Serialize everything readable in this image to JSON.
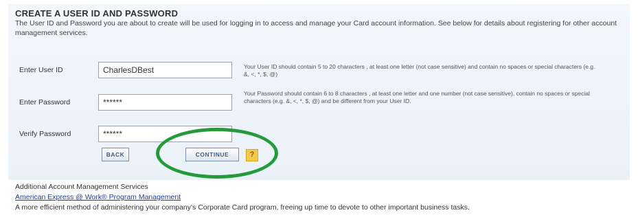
{
  "form": {
    "title": "CREATE A USER ID AND PASSWORD",
    "intro": "The User ID and Password you are about to create will be used for logging in to access and manage your Card account information. See below for details about registering for other account management services.",
    "user_id": {
      "label": "Enter User ID",
      "value": "CharlesDBest",
      "hint": "Your User ID should contain 5 to 20 characters , at least one letter (not case sensitive) and contain no spaces or special characters (e.g. &, <, *, $, @)"
    },
    "password": {
      "label": "Enter Password",
      "value": "******",
      "hint": "Your Password should contain 6 to 8 characters , at least one letter and one number (not case sensitive), contain no spaces or special characters (e.g. &, <, *, $, @) and be different from your User ID."
    },
    "verify_password": {
      "label": "Verify Password",
      "value": "******"
    },
    "back_label": "BACK",
    "continue_label": "CONTINUE",
    "help_label": "?"
  },
  "additional": {
    "heading": "Additional Account Management Services",
    "link_text": "American Express @ Work® Program Management",
    "description": "A more efficient method of administering your company's Corporate Card program, freeing up time to devote to other important business tasks."
  },
  "colors": {
    "highlight_ellipse": "#249a3a",
    "link": "#1a3fa8",
    "button_text": "#3b5f8a"
  }
}
